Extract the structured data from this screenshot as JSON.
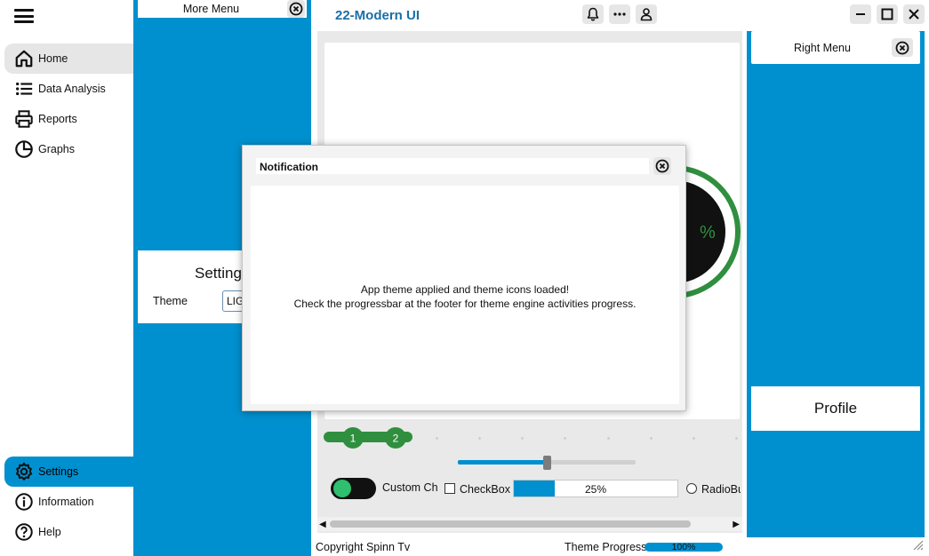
{
  "app": {
    "title": "22-Modern UI"
  },
  "sidebar": {
    "items": [
      {
        "label": "Home",
        "icon": "home-icon"
      },
      {
        "label": "Data Analysis",
        "icon": "list-icon"
      },
      {
        "label": "Reports",
        "icon": "printer-icon"
      },
      {
        "label": "Graphs",
        "icon": "pie-chart-icon"
      }
    ],
    "bottom_items": [
      {
        "label": "Settings",
        "icon": "gear-icon"
      },
      {
        "label": "Information",
        "icon": "info-icon"
      },
      {
        "label": "Help",
        "icon": "help-icon"
      }
    ]
  },
  "more_menu": {
    "title": "More Menu"
  },
  "settings_panel": {
    "title": "Setting",
    "theme_label": "Theme",
    "theme_value": "LIG"
  },
  "right_menu": {
    "title": "Right Menu",
    "profile_label": "Profile"
  },
  "main": {
    "gauge_text": "%",
    "stepper": {
      "steps": [
        "1",
        "2"
      ]
    },
    "slider": {
      "value": 0.5
    },
    "toggle_on": true,
    "custom_checkbox_label": "Custom Ch",
    "checkbox_label": "CheckBox",
    "progress": {
      "text": "25%",
      "value": 0.25
    },
    "radio_label": "RadioBu"
  },
  "notification": {
    "title": "Notification",
    "line1": "App theme applied and theme icons loaded!",
    "line2": "Check the progressbar at the footer for theme engine activities progress."
  },
  "footer": {
    "copyright": "Copyright Spinn Tv",
    "theme_progress_label": "Theme Progress",
    "theme_progress_text": "100%",
    "theme_progress_value": 1.0
  },
  "colors": {
    "accent": "#0090cf",
    "title": "#1a6fa8",
    "green": "#2f8f3f",
    "toggle_knob": "#2fbf6e"
  }
}
